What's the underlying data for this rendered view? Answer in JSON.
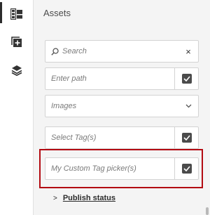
{
  "rail": {
    "items": [
      {
        "icon": "assets-icon",
        "active": true
      },
      {
        "icon": "add-content-icon",
        "active": false
      },
      {
        "icon": "layers-icon",
        "active": false
      }
    ]
  },
  "panel": {
    "title": "Assets",
    "search": {
      "placeholder": "Search",
      "clear_glyph": "×"
    },
    "path": {
      "placeholder": "Enter path"
    },
    "asset_type": {
      "value": "Images"
    },
    "tags": {
      "placeholder": "Select Tag(s)"
    },
    "custom_tags": {
      "placeholder": "My Custom Tag picker(s)"
    },
    "publish_status": {
      "arrow": ">",
      "label": "Publish status"
    }
  },
  "colors": {
    "highlight_border": "#b30b12",
    "panel_bg": "#f4f4f4",
    "checkbox": "#4b4b4b"
  }
}
